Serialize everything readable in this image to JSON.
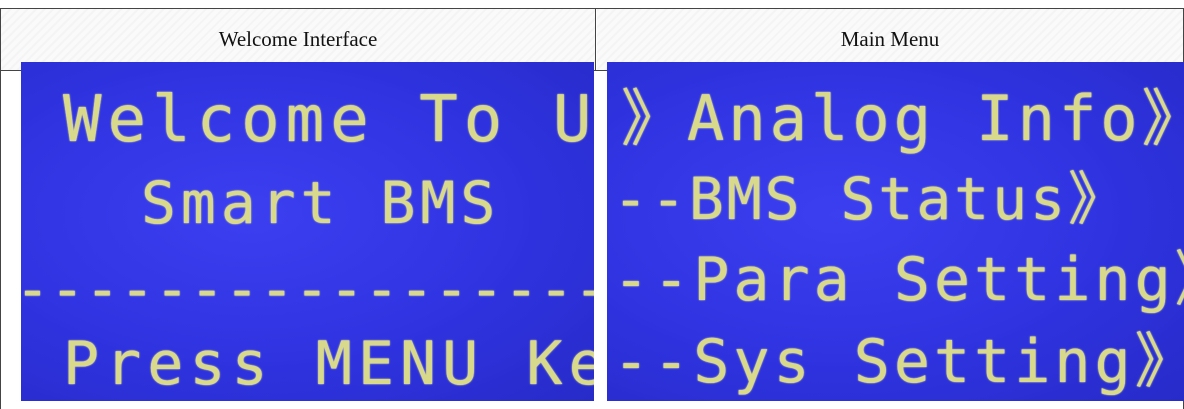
{
  "table": {
    "headers": {
      "left": "Welcome Interface",
      "right": "Main Menu"
    }
  },
  "welcome_screen": {
    "line1": "Welcome To Use",
    "line2": "Smart BMS",
    "divider": "-----------------",
    "line4": "Press MENU Key"
  },
  "main_menu_screen": {
    "items": [
      "》Analog Info》",
      "--BMS Status》",
      "--Para Setting》",
      "--Sys Setting》"
    ]
  },
  "colors": {
    "lcd_background": "#2f33e0",
    "lcd_text": "#d8d98a"
  }
}
